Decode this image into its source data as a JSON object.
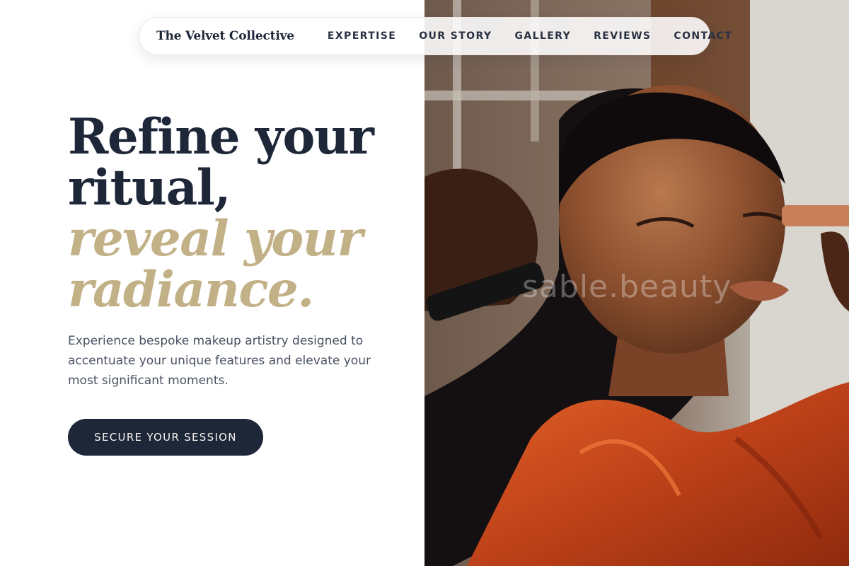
{
  "brand": {
    "name": "The Velvet Collective"
  },
  "nav": {
    "links": [
      "EXPERTISE",
      "OUR STORY",
      "GALLERY",
      "REVIEWS",
      "CONTACT"
    ]
  },
  "hero": {
    "headline_line1": "Refine your",
    "headline_line2": "ritual,",
    "headline_accent_line1": "reveal your",
    "headline_accent_line2": "radiance.",
    "subtext": "Experience bespoke makeup artistry designed to accentuate your unique features and elevate your most significant moments.",
    "cta_label": "SECURE YOUR SESSION"
  },
  "photo": {
    "description_icon": "makeup-artist-photo",
    "watermark": "sable.beauty"
  },
  "colors": {
    "navy": "#1e2738",
    "gold_accent": "#c2b187",
    "body_text": "#4a5262",
    "background": "#ffffff"
  }
}
